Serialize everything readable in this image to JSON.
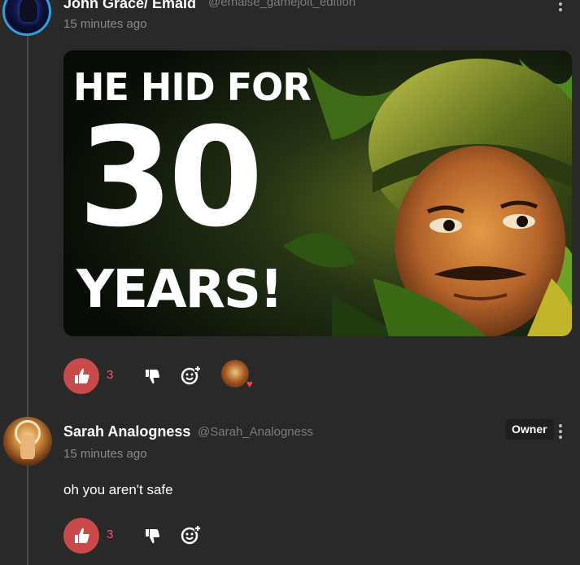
{
  "post": {
    "author_name": "John Grace/ Emaid",
    "author_handle": "@emaise_gamejolt_edition",
    "time": "15 minutes ago",
    "thumbnail": {
      "line1": "HE HID FOR",
      "line2": "30",
      "line3": "YEARS!"
    },
    "likes": "3"
  },
  "reply": {
    "author_name": "Sarah Analogness",
    "author_handle": "@Sarah_Analogness",
    "badge": "Owner",
    "time": "15 minutes ago",
    "text": "oh you aren't safe",
    "likes": "3"
  },
  "colors": {
    "background": "#292929",
    "like_button": "#c94a4a",
    "like_count": "#ff4d6d",
    "handle": "#7c7c7c",
    "heart": "#ff3b55"
  },
  "icons": [
    "thumbs-up-icon",
    "thumbs-down-icon",
    "add-reaction-icon",
    "more-vertical-icon",
    "heart-icon"
  ]
}
